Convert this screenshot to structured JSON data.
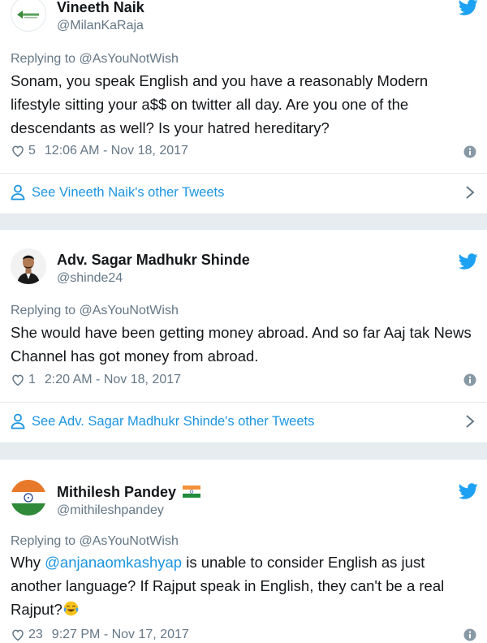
{
  "colors": {
    "link": "#1b95e0",
    "secondary_text": "#657786",
    "primary_text": "#14171a",
    "background": "#e6ecf0"
  },
  "tweets": [
    {
      "display_name": "Vineeth Naik",
      "handle": "@MilanKaRaja",
      "replying_to": "Replying to @AsYouNotWish",
      "text": "Sonam, you speak English and you have a reasonably Modern lifestyle sitting your a$$ on twitter all day. Are you one of the descendants as well? Is your hatred hereditary?",
      "likes": "5",
      "timestamp": "12:06 AM - Nov 18, 2017",
      "other_tweets_link": "See Vineeth Naik's other Tweets"
    },
    {
      "display_name": "Adv. Sagar Madhukr Shinde",
      "handle": "@shinde24",
      "replying_to": "Replying to @AsYouNotWish",
      "text": "She would have been getting money abroad. And so far Aaj tak News Channel has got money from abroad.",
      "likes": "1",
      "timestamp": "2:20 AM - Nov 18, 2017",
      "other_tweets_link": "See Adv. Sagar Madhukr Shinde's other Tweets"
    },
    {
      "display_name": "Mithilesh Pandey",
      "handle": "@mithileshpandey",
      "replying_to": "Replying to @AsYouNotWish",
      "text_prefix": "Why ",
      "text_mention": "@anjanaomkashyap",
      "text_suffix": " is unable to consider English as just another language? If Rajput speak in English, they can't be a real Rajput?",
      "likes": "23",
      "timestamp": "9:27 PM - Nov 17, 2017"
    }
  ],
  "icons": {
    "twitter_bird": "twitter-bird-icon",
    "heart": "heart-icon",
    "info": "info-icon",
    "person": "person-icon",
    "chevron": "chevron-right-icon",
    "flag": "india-flag-icon",
    "emoji": "tears-of-joy-emoji-icon"
  }
}
